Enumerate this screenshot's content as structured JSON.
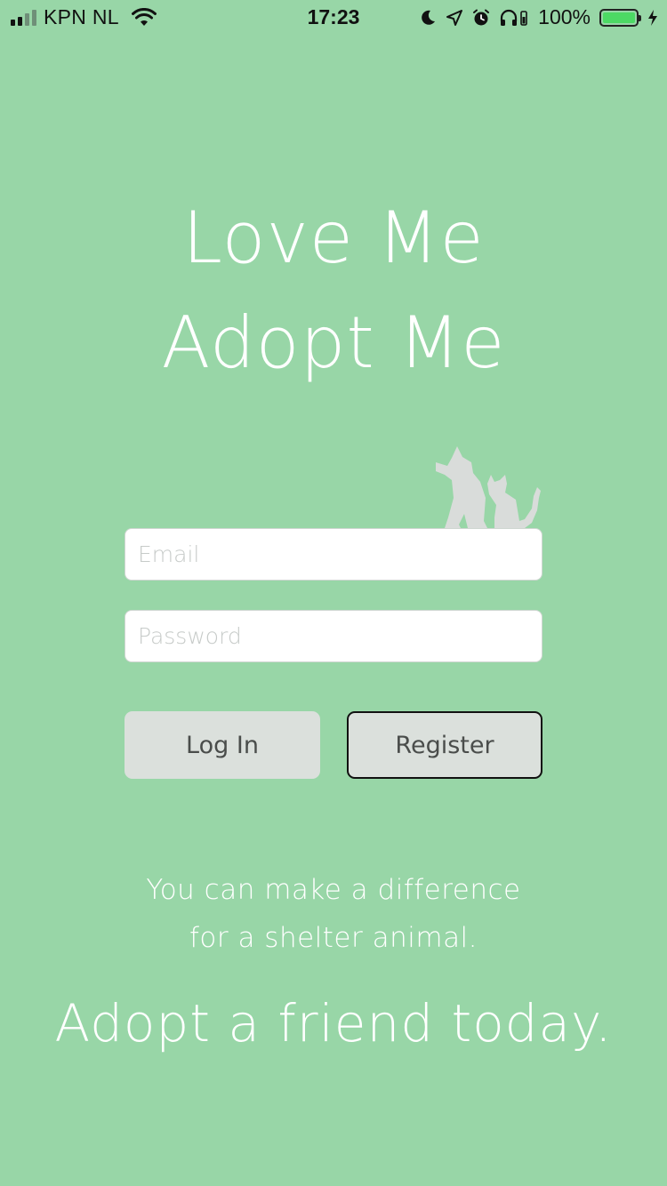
{
  "status_bar": {
    "carrier": "KPN NL",
    "time": "17:23",
    "battery_percent": "100%",
    "battery_level": 1.0,
    "icons": [
      "signal-icon",
      "wifi-icon",
      "moon-icon",
      "location-icon",
      "alarm-icon",
      "headphones-icon",
      "battery-icon",
      "charging-icon"
    ]
  },
  "headline": {
    "line1": "Love Me",
    "line2": "Adopt Me"
  },
  "illustration": {
    "icon": "dog-and-cat-icon",
    "color": "#d9dcda"
  },
  "form": {
    "email_placeholder": "Email",
    "password_placeholder": "Password",
    "login_label": "Log In",
    "register_label": "Register"
  },
  "tagline": {
    "line1": "You can make a difference",
    "line2": "for a shelter animal.",
    "cta": "Adopt a friend today."
  },
  "colors": {
    "background": "#98d6a7",
    "button": "#dbe0dc",
    "text": "#ffffff"
  }
}
